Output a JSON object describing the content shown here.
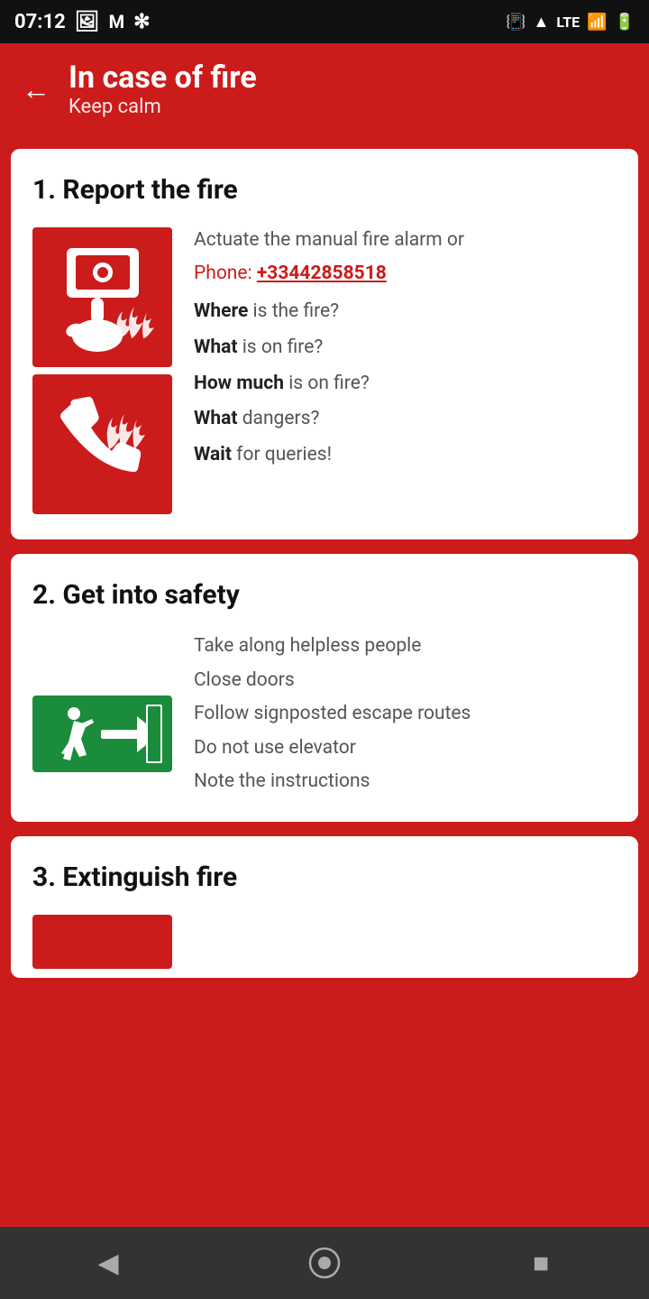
{
  "statusBar": {
    "time": "07:12",
    "icons": [
      "photo",
      "email",
      "pinwheel",
      "vibrate",
      "wifi",
      "lte",
      "signal",
      "battery"
    ]
  },
  "header": {
    "title": "In case of fire",
    "subtitle": "Keep calm"
  },
  "sections": [
    {
      "id": "report",
      "title": "1. Report the fire",
      "description": "Actuate the manual fire alarm or",
      "phone_label": "Phone: ",
      "phone_number": "+33442858518",
      "questions": [
        {
          "bold": "Where",
          "rest": " is the fire?"
        },
        {
          "bold": "What",
          "rest": " is on fire?"
        },
        {
          "bold": "How much",
          "rest": " is on fire?"
        },
        {
          "bold": "What",
          "rest": " dangers?"
        },
        {
          "bold": "Wait",
          "rest": " for queries!"
        }
      ]
    },
    {
      "id": "safety",
      "title": "2. Get into safety",
      "items": [
        "Take along helpless people",
        "Close doors",
        "Follow signposted escape routes",
        "Do not use elevator",
        "Note the instructions"
      ]
    },
    {
      "id": "extinguish",
      "title": "3. Extinguish fire"
    }
  ],
  "navBar": {
    "back": "◀",
    "home": "⬤",
    "recent": "■"
  }
}
